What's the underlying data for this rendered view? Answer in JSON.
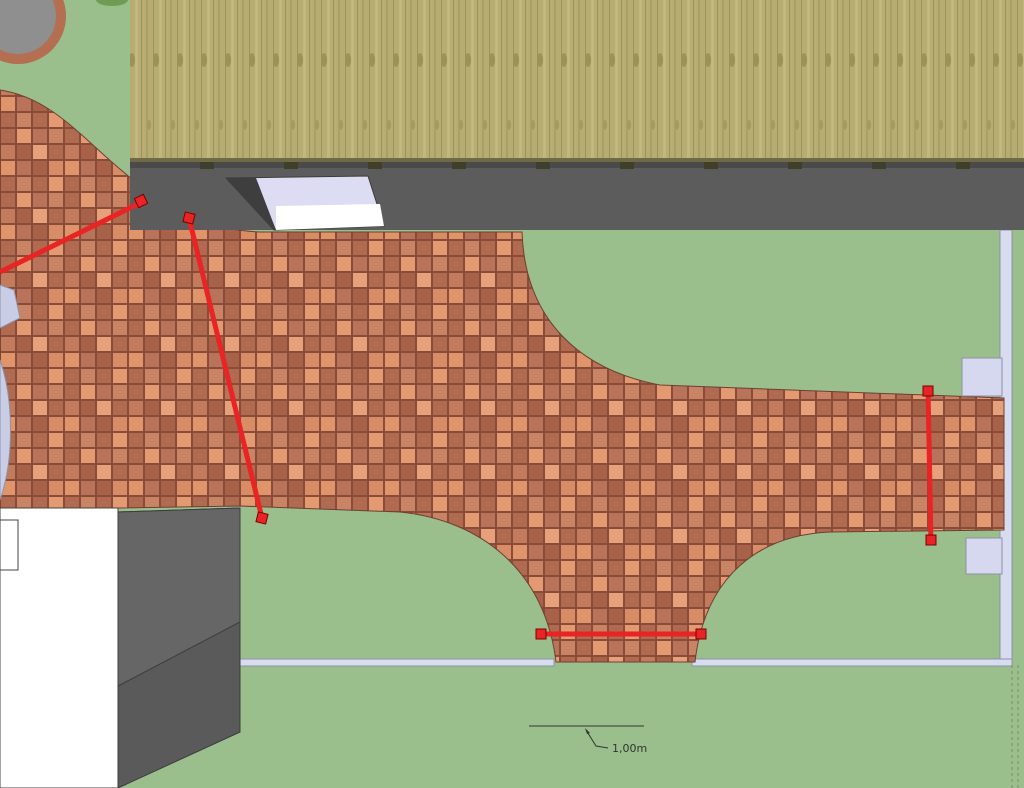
{
  "scale_bar": {
    "label": "1,00m"
  },
  "colors": {
    "lawn": "#9bbf8c",
    "paving_base": "#b46e52",
    "paving_mortar": "#8a4b39",
    "paver_light": "#e39a70",
    "paver_mid": "#c78766",
    "paver_dark": "#a5604a",
    "roof_base": "#b7ad72",
    "roof_grain": "#8f8655",
    "wall_dark": "#5a5a5a",
    "wall_mid": "#6b6b6b",
    "wall_light": "#dcdcf2",
    "curb": "#c9cde6",
    "measure_line": "#e82424"
  },
  "icons": [
    "scale-bar-icon",
    "leader-arrow-icon"
  ]
}
